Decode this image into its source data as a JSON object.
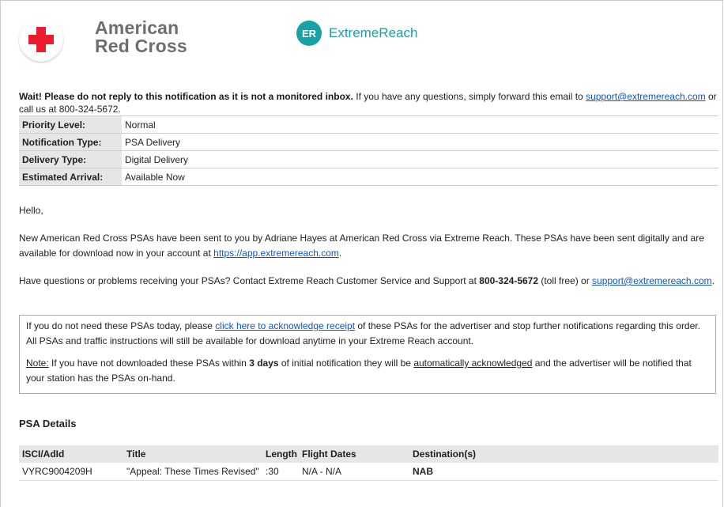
{
  "header": {
    "brand_left_line1": "American",
    "brand_left_line2": "Red Cross",
    "brand_right_badge": "ER",
    "brand_right_name": "ExtremeReach"
  },
  "notice": {
    "bold": "Wait! Please do not reply to this notification as it is not a monitored inbox.",
    "text1": " If you have any questions, simply forward this email to ",
    "email": "support@extremereach.com",
    "text2": " or call us at 800-324-5672."
  },
  "info_rows": [
    {
      "label": "Priority Level:",
      "value": "Normal"
    },
    {
      "label": "Notification Type:",
      "value": "PSA Delivery"
    },
    {
      "label": "Delivery Type:",
      "value": "Digital Delivery"
    },
    {
      "label": "Estimated Arrival:",
      "value": "Available Now"
    }
  ],
  "body": {
    "greeting": "Hello,",
    "para1_text": "New American Red Cross PSAs have been sent to you by Adriane Hayes at American Red Cross via Extreme Reach. These PSAs have been sent digitally and are available for download now in your account at ",
    "para1_link": "https://app.extremereach.com",
    "para1_end": ".",
    "para2_text": "Have questions or problems receiving your PSAs? Contact Extreme Reach Customer Service and Support at ",
    "para2_phone": "800-324-5672",
    "para2_mid": " (toll free) or ",
    "para2_link": "support@extremereach.com",
    "para2_end": "."
  },
  "ack_box": {
    "text1": "If you do not need these PSAs today, please ",
    "link": "click here to acknowledge receipt",
    "text2": " of these PSAs for the advertiser and stop further notifications regarding this order. All PSAs and traffic instructions will still be available for download anytime in your Extreme Reach account.",
    "note_label": "Note:",
    "note_text1": "  If you have not downloaded these PSAs within ",
    "note_days": "3 days",
    "note_text2": " of initial notification they will be ",
    "note_auto": "automatically acknowledged",
    "note_text3": " and the advertiser will be notified that your station has the PSAs on-hand."
  },
  "psa": {
    "heading": "PSA Details",
    "columns": [
      "ISCI/AdId",
      "Title",
      "Length",
      "Flight Dates",
      "Destination(s)"
    ],
    "rows": [
      {
        "isci": "VYRC9004209H",
        "title": "\"Appeal: These Times Revised\"",
        "length": ":30",
        "flight": "N/A - N/A",
        "destination": "NAB"
      }
    ]
  }
}
